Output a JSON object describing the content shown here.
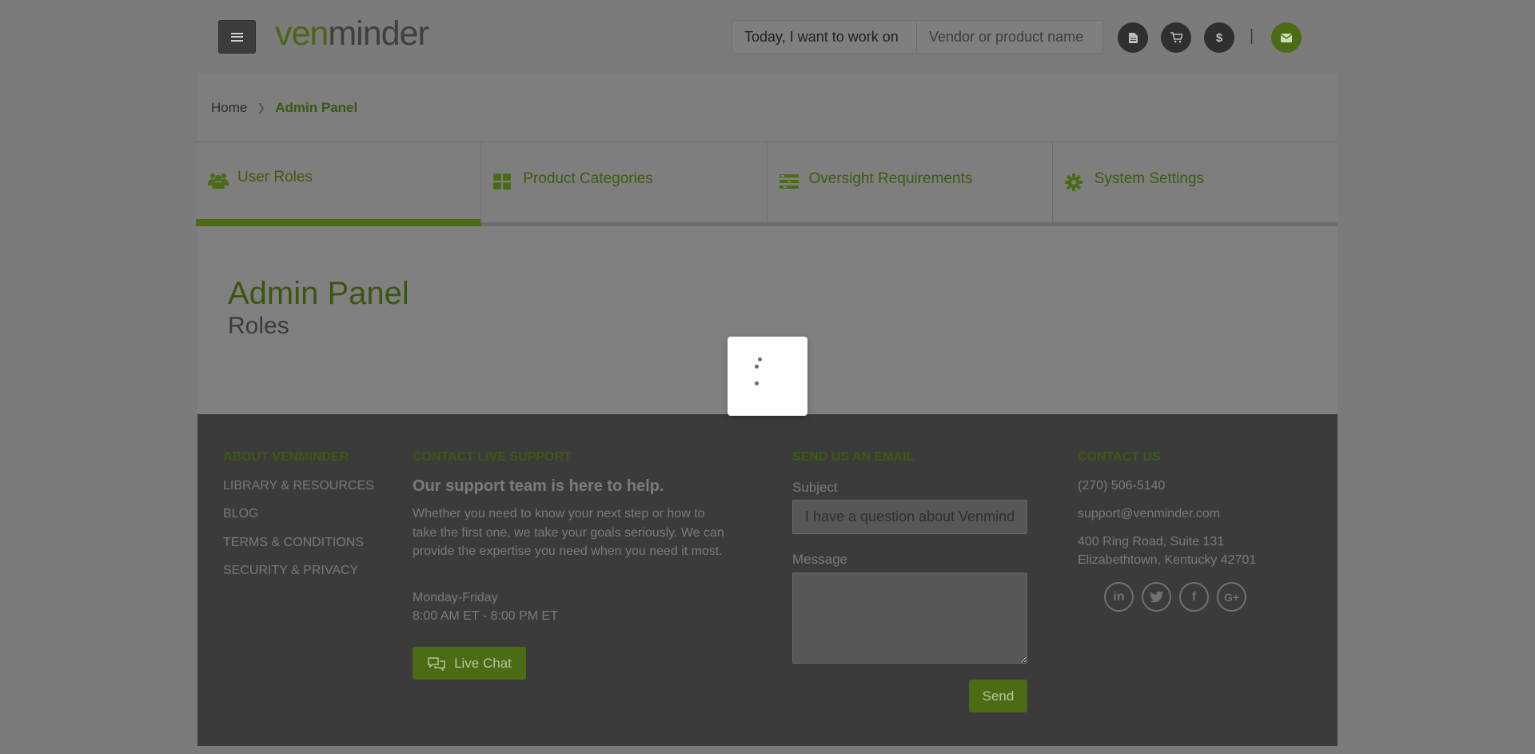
{
  "header": {
    "logo_ven": "ven",
    "logo_minder": "minder",
    "search_label": "Today, I want to work on",
    "search_placeholder": "Vendor or product name",
    "buttons": [
      {
        "icon": "document-icon",
        "glyph": "🗎"
      },
      {
        "icon": "cart-icon",
        "glyph": "🛒"
      },
      {
        "icon": "dollar-icon",
        "glyph": "$"
      },
      {
        "icon": "mail-icon",
        "glyph": "✉"
      }
    ],
    "separator": "|"
  },
  "breadcrumb": {
    "home": "Home",
    "separator": "❯",
    "current": "Admin Panel"
  },
  "tabs": [
    {
      "label": "User Roles",
      "icon": "users-icon",
      "active": true
    },
    {
      "label": "Product Categories",
      "icon": "grid-icon",
      "active": false
    },
    {
      "label": "Oversight Requirements",
      "icon": "list-icon",
      "active": false
    },
    {
      "label": "System Settings",
      "icon": "gear-icon",
      "active": false
    }
  ],
  "content": {
    "title": "Admin Panel",
    "subtitle": "Roles"
  },
  "footer": {
    "about": {
      "heading": "ABOUT VENMINDER",
      "links": [
        "LIBRARY & RESOURCES",
        "BLOG",
        "TERMS & CONDITIONS",
        "SECURITY & PRIVACY"
      ]
    },
    "support": {
      "heading": "CONTACT LIVE SUPPORT",
      "tagline": "Our support team is here to help.",
      "body_lines": [
        "Whether you need to know your next step or how to",
        "take the first one, we take your goals seriously. We can",
        "provide the expertise you need when you need it most."
      ],
      "hours_days": "Monday-Friday",
      "hours_time": "8:00 AM ET - 8:00 PM ET",
      "chat_label": "Live Chat"
    },
    "email": {
      "heading": "SEND US AN EMAIL",
      "subject_label": "Subject",
      "subject_value": "I have a question about Venminder",
      "message_label": "Message",
      "send_label": "Send"
    },
    "contact": {
      "heading": "CONTACT US",
      "phone": "(270) 506-5140",
      "email": "support@venminder.com",
      "address_line1": "400 Ring Road, Suite 131",
      "address_line2": "Elizabethtown, Kentucky 42701",
      "social": [
        {
          "icon": "linkedin-icon",
          "glyph": "in"
        },
        {
          "icon": "twitter-icon",
          "glyph": "🐦"
        },
        {
          "icon": "facebook-icon",
          "glyph": "f"
        },
        {
          "icon": "google-plus-icon",
          "glyph": "G+"
        }
      ]
    }
  },
  "colors": {
    "accent_green": "#4b6b15",
    "overlay": "#7b7b7b",
    "footer_bg": "#3b3b3b"
  }
}
